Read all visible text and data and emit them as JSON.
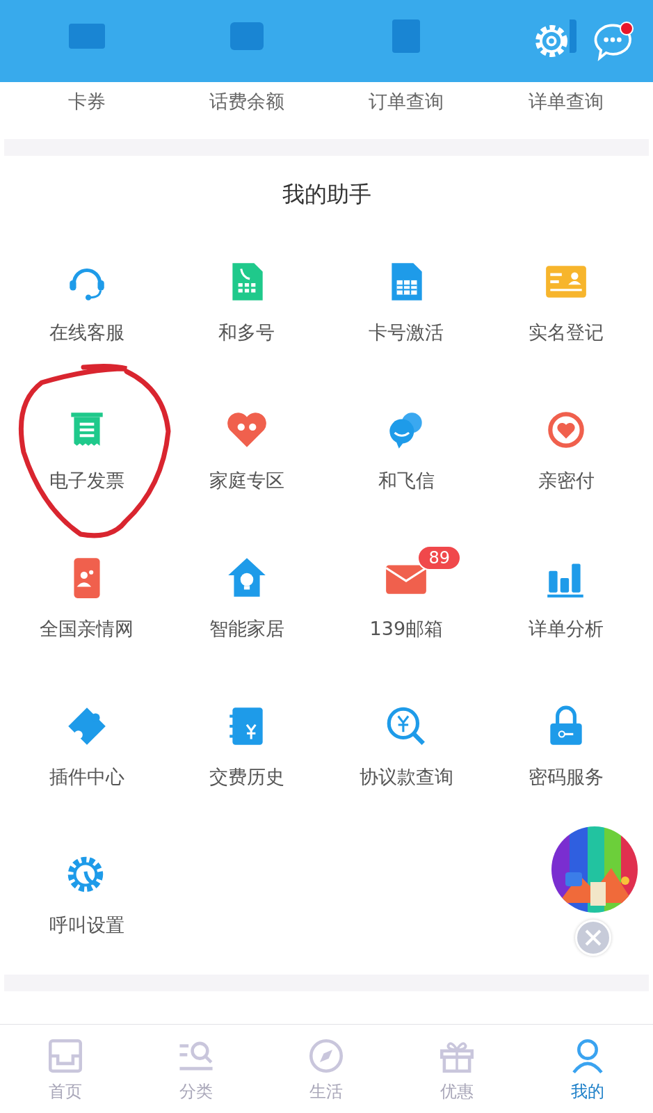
{
  "header": {
    "messages": {
      "unread": true
    }
  },
  "top_shortcuts": [
    {
      "label": "卡券"
    },
    {
      "label": "话费余额"
    },
    {
      "label": "订单查询"
    },
    {
      "label": "详单查询"
    }
  ],
  "assistant": {
    "title": "我的助手",
    "items": [
      {
        "label": "在线客服"
      },
      {
        "label": "和多号"
      },
      {
        "label": "卡号激活"
      },
      {
        "label": "实名登记"
      },
      {
        "label": "电子发票"
      },
      {
        "label": "家庭专区"
      },
      {
        "label": "和飞信"
      },
      {
        "label": "亲密付"
      },
      {
        "label": "全国亲情网"
      },
      {
        "label": "智能家居"
      },
      {
        "label": "139邮箱",
        "badge": "89"
      },
      {
        "label": "详单分析"
      },
      {
        "label": "插件中心"
      },
      {
        "label": "交费历史"
      },
      {
        "label": "协议款查询"
      },
      {
        "label": "密码服务"
      },
      {
        "label": "呼叫设置"
      }
    ]
  },
  "tab_bar": [
    {
      "label": "首页",
      "selected": false
    },
    {
      "label": "分类",
      "selected": false
    },
    {
      "label": "生活",
      "selected": false
    },
    {
      "label": "优惠",
      "selected": false
    },
    {
      "label": "我的",
      "selected": true
    }
  ]
}
